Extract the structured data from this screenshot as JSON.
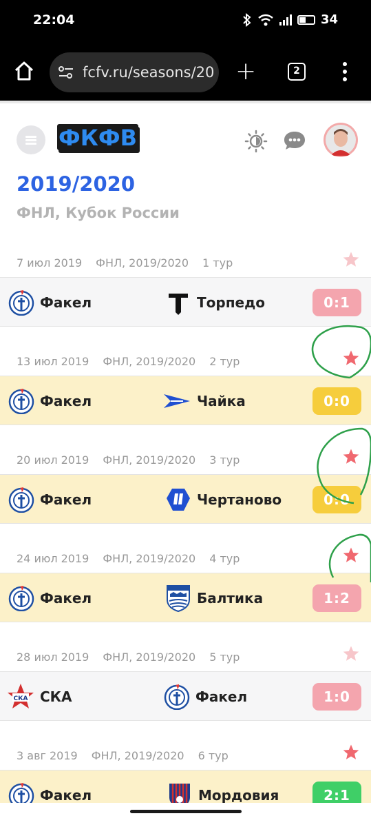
{
  "status": {
    "time": "22:04",
    "battery": "34"
  },
  "browser": {
    "url": "fcfv.ru/seasons/20",
    "tab_count": "2"
  },
  "header": {
    "logo_text": "ФКФВ"
  },
  "season": {
    "title": "2019/2020",
    "subtitle": "ФНЛ, Кубок России"
  },
  "matches": [
    {
      "date": "7 июл 2019",
      "tournament": "ФНЛ, 2019/2020",
      "round": "1 тур",
      "home": "Факел",
      "away": "Торпедо",
      "score": "0:1",
      "favorite": false
    },
    {
      "date": "13 июл 2019",
      "tournament": "ФНЛ, 2019/2020",
      "round": "2 тур",
      "home": "Факел",
      "away": "Чайка",
      "score": "0:0",
      "favorite": true
    },
    {
      "date": "20 июл 2019",
      "tournament": "ФНЛ, 2019/2020",
      "round": "3 тур",
      "home": "Факел",
      "away": "Чертаново",
      "score": "0:0",
      "favorite": true
    },
    {
      "date": "24 июл 2019",
      "tournament": "ФНЛ, 2019/2020",
      "round": "4 тур",
      "home": "Факел",
      "away": "Балтика",
      "score": "1:2",
      "favorite": true
    },
    {
      "date": "28 июл 2019",
      "tournament": "ФНЛ, 2019/2020",
      "round": "5 тур",
      "home": "СКА",
      "away": "Факел",
      "score": "1:0",
      "favorite": false
    },
    {
      "date": "3 авг 2019",
      "tournament": "ФНЛ, 2019/2020",
      "round": "6 тур",
      "home": "Факел",
      "away": "Мордовия",
      "score": "2:1",
      "favorite": true
    }
  ],
  "colors": {
    "accent_blue": "#2d63e2",
    "loss": "#f4a5ae",
    "draw": "#f6cd3c",
    "win": "#3fcf67",
    "star_active": "#f0686f",
    "star_inactive": "#f7c6ca",
    "fav_row": "#fcf1c9",
    "plain_row": "#f6f6f7"
  }
}
